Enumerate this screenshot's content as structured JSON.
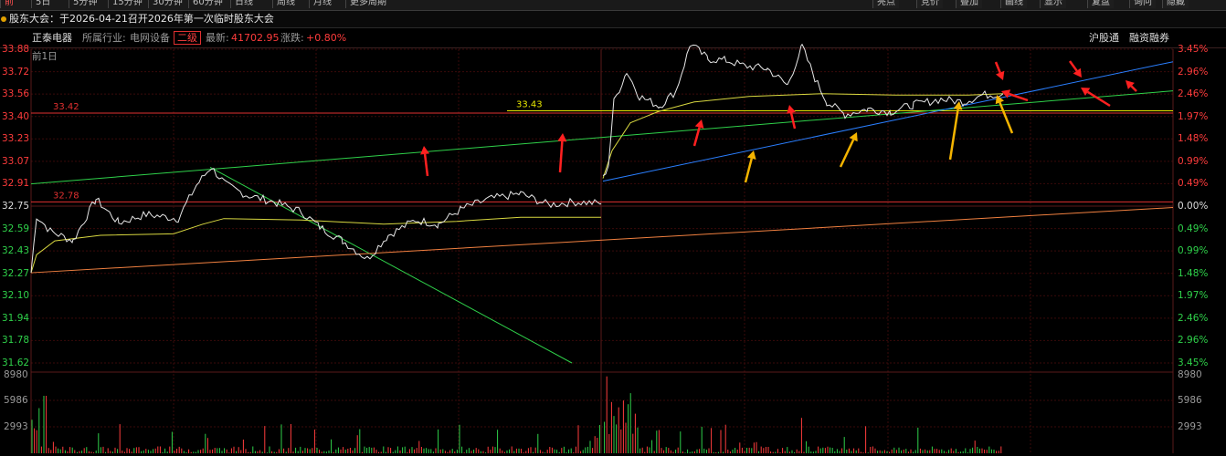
{
  "toolbar": {
    "tabs": [
      "前",
      "5日",
      "5分钟",
      "15分钟",
      "30分钟",
      "60分钟",
      "日线",
      "周线",
      "月线",
      "更多周期"
    ],
    "right_buttons": [
      "亮点",
      "竞价",
      "叠加",
      "画线",
      "显示",
      "复盘",
      "询问",
      "隐藏"
    ]
  },
  "notice": {
    "text": "股东大会：于2026-04-21召开2026年第一次临时股东大会"
  },
  "info": {
    "stock_name": "正泰电器",
    "industry_label": "所属行业:",
    "industry": "电网设备",
    "level_badge": "二级",
    "latest_label": "最新:",
    "latest": "41702.95",
    "change_label": "涨跌:",
    "change": "+0.80%",
    "hk_connect": "沪股通",
    "margin": "融资融券"
  },
  "chart": {
    "period_label": "前1日",
    "price_ticks": [
      "33.88",
      "33.72",
      "33.56",
      "33.40",
      "33.23",
      "33.07",
      "32.91",
      "32.75",
      "32.59",
      "32.43",
      "32.27",
      "32.10",
      "31.94",
      "31.78",
      "31.62"
    ],
    "pct_ticks": [
      "3.45%",
      "2.96%",
      "2.46%",
      "1.97%",
      "1.48%",
      "0.99%",
      "0.49%",
      "0.00%",
      "0.49%",
      "0.99%",
      "1.48%",
      "1.97%",
      "2.46%",
      "2.96%",
      "3.45%"
    ],
    "level_lines": [
      {
        "label": "33.42",
        "price": 33.42,
        "color": "#e03030"
      },
      {
        "label": "33.43",
        "price": 33.43,
        "color": "#e8e800"
      },
      {
        "label": "32.78",
        "price": 32.78,
        "color": "#e03030"
      }
    ],
    "volume_ticks": [
      "8980",
      "5986",
      "2993"
    ],
    "colors": {
      "up": "#ff3c3c",
      "down": "#2fd14a",
      "price_line": "#e8e8e8",
      "avg_line": "#d8d840",
      "grid": "#3a0a0a",
      "trend_green": "#2fd14a",
      "trend_blue": "#2a7fff",
      "trend_orange": "#f08040",
      "arrow_red": "#ff2020",
      "arrow_yellow": "#f4b400"
    }
  }
}
